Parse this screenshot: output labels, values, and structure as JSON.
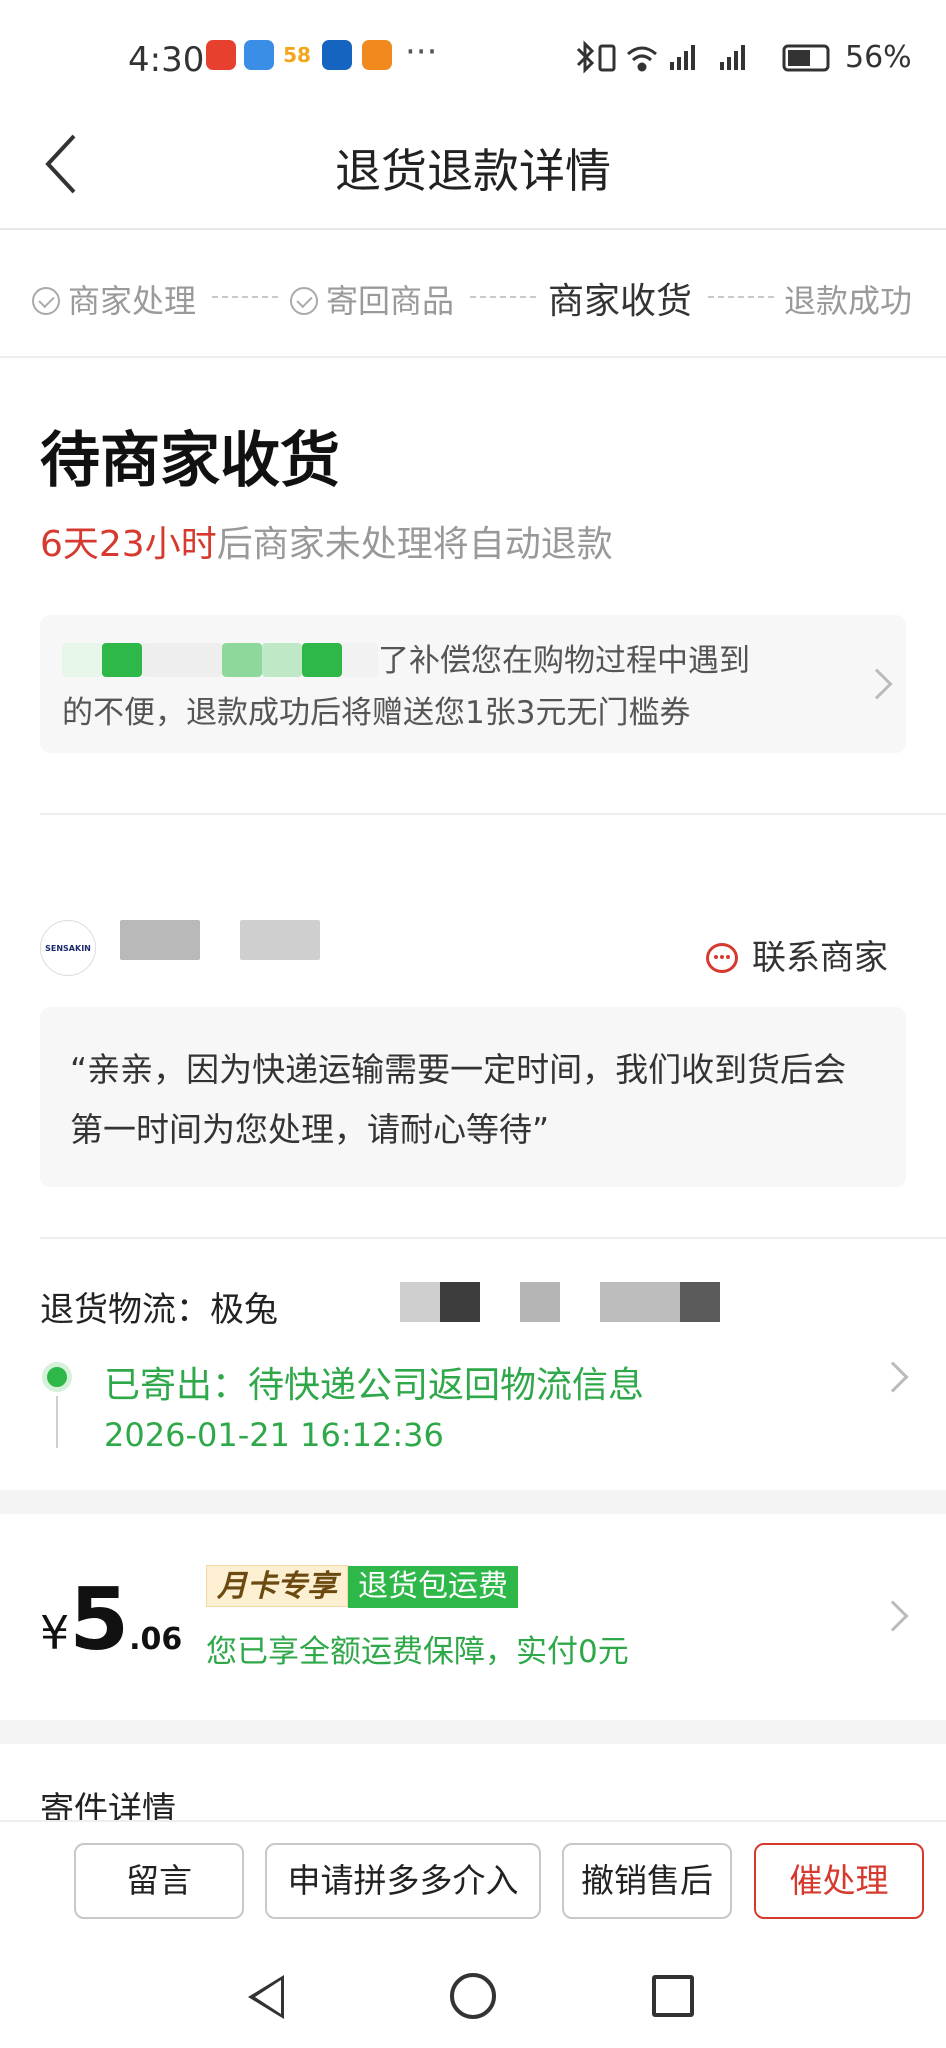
{
  "status_bar": {
    "time": "4:30",
    "app_icons": [
      {
        "name": "pinduoduo-icon",
        "color": "#e8402f"
      },
      {
        "name": "cloud-icon",
        "color": "#3a8ee6"
      },
      {
        "name": "58-icon",
        "color": "#f2a619",
        "label": "58"
      },
      {
        "name": "robot-app-icon",
        "color": "#1565c0"
      },
      {
        "name": "video-app-icon",
        "color": "#f08a1e"
      }
    ],
    "more": "···",
    "battery": "56%"
  },
  "header": {
    "title": "退货退款详情"
  },
  "steps": [
    {
      "label": "商家处理",
      "done": true
    },
    {
      "label": "寄回商品",
      "done": true
    },
    {
      "label": "商家收货",
      "active": true
    },
    {
      "label": "退款成功"
    }
  ],
  "status": {
    "title": "待商家收货",
    "countdown": "6天23小时",
    "countdown_suffix": "后商家未处理将自动退款"
  },
  "coupon": {
    "text_line1": "了补偿您在购物过程中遇到",
    "text_line2": "的不便，退款成功后将赠送您1张3元无门槛券"
  },
  "merchant": {
    "avatar_text": "SENSAKIN",
    "contact_label": "联系商家",
    "quote": "“亲亲，因为快递运输需要一定时间，我们收到货后会第一时间为您处理，请耐心等待”"
  },
  "logistics": {
    "label": "退货物流：",
    "carrier": "极兔",
    "status": "已寄出：待快递公司返回物流信息",
    "time": "2026-01-21 16:12:36"
  },
  "price": {
    "currency": "¥",
    "integer": "5",
    "decimal": ".06",
    "badge_left": "月卡专享",
    "badge_right": "退货包运费",
    "note": "您已享全额运费保障，实付0元"
  },
  "shipping_detail": {
    "label": "寄件详情"
  },
  "actions": {
    "message": "留言",
    "appeal": "申请拼多多介入",
    "cancel": "撤销售后",
    "urge": "催处理"
  },
  "colors": {
    "accent_red": "#d63a2f",
    "success_green": "#2fa84a"
  }
}
